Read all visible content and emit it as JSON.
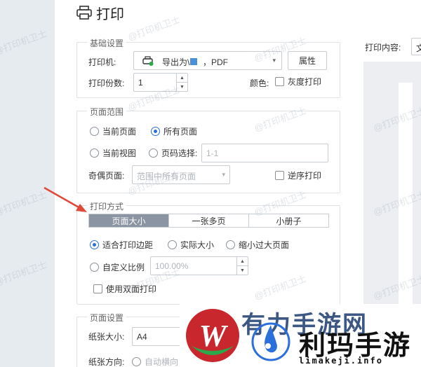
{
  "dialog": {
    "title": "打印"
  },
  "basic": {
    "legend": "基础设置",
    "printer_label": "打印机:",
    "printer_value": "导出为\\",
    "printer_value_tail": "，PDF",
    "properties_button": "属性",
    "copies_label": "打印份数:",
    "copies_value": "1",
    "color_label": "颜色:",
    "grayscale_label": "灰度打印"
  },
  "range": {
    "legend": "页面范围",
    "current_page": "当前页面",
    "all_pages": "所有页面",
    "current_view": "当前视图",
    "page_select": "页码选择:",
    "page_select_placeholder": "1-1",
    "odd_even_label": "奇偶页面:",
    "odd_even_value": "范围中所有页面",
    "reverse_label": "逆序打印"
  },
  "method": {
    "legend": "打印方式",
    "tabs": [
      "页面大小",
      "一张多页",
      "小册子"
    ],
    "active_tab": "页面大小",
    "fit_margins": "适合打印边距",
    "actual_size": "实际大小",
    "shrink_large": "缩小过大页面",
    "custom_scale": "自定义比例",
    "scale_value": "100.00%",
    "duplex_label": "使用双面打印"
  },
  "page_setup": {
    "legend": "页面设置",
    "paper_size_label": "纸张大小:",
    "paper_size_value": "A4",
    "orientation_label": "纸张方向:",
    "auto_rotate_label": "自动横向"
  },
  "preview": {
    "content_label": "打印内容:",
    "content_value": "文"
  },
  "watermark_text": "@打印机卫士",
  "overlay": {
    "headline": "有力手游网",
    "brand": "利玛手游",
    "url": "limakeji.info"
  },
  "colors": {
    "accent": "#2a6fdb",
    "active_tab": "#8b94a3",
    "arrow": "#e0483a",
    "logo_red": "#c8282d",
    "logo_green": "#2aa84a"
  }
}
